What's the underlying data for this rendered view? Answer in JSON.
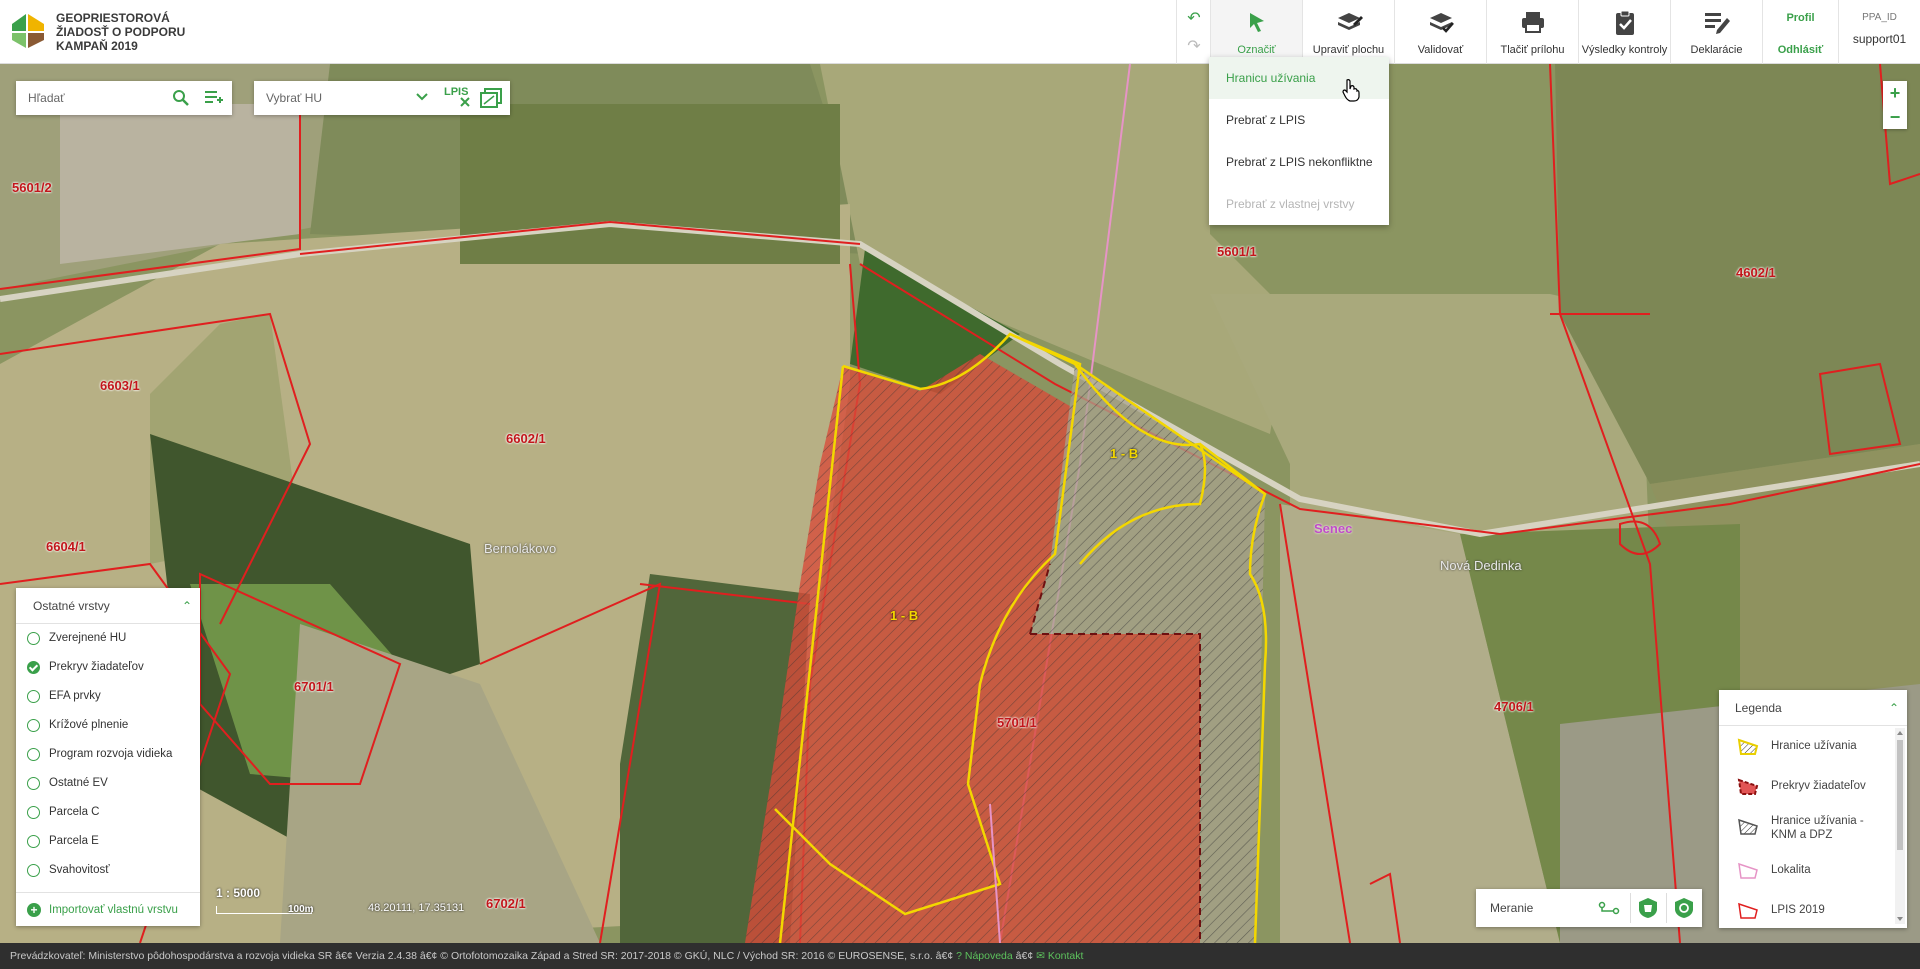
{
  "app": {
    "title_lines": [
      "GEOPRIESTOROVÁ",
      "ŽIADOSŤ O PODPORU",
      "KAMPAŇ 2019"
    ]
  },
  "toolbar": {
    "items": [
      {
        "label": "Označiť",
        "icon": "pointer-icon",
        "active": true
      },
      {
        "label": "Upraviť plochu",
        "icon": "edit-area-icon"
      },
      {
        "label": "Validovať",
        "icon": "validate-icon"
      },
      {
        "label": "Tlačiť prílohu",
        "icon": "print-icon"
      },
      {
        "label": "Výsledky kontroly",
        "icon": "clipboard-check-icon"
      },
      {
        "label": "Deklarácie",
        "icon": "declaration-icon"
      }
    ],
    "profile_label": "Profil",
    "logout_label": "Odhlásiť",
    "user_id_label": "PPA_ID",
    "user_name": "support01"
  },
  "dropdown": {
    "items": [
      {
        "label": "Hranicu užívania",
        "state": "active"
      },
      {
        "label": "Prebrať z LPIS",
        "state": "normal"
      },
      {
        "label": "Prebrať z LPIS nekonfliktne",
        "state": "normal"
      },
      {
        "label": "Prebrať z vlastnej vrstvy",
        "state": "disabled"
      }
    ]
  },
  "search": {
    "placeholder": "Hľadať",
    "hu_placeholder": "Vybrať HU",
    "lpis_label": "LPIS"
  },
  "layers": {
    "title": "Ostatné vrstvy",
    "items": [
      {
        "label": "Zverejnené HU",
        "checked": false
      },
      {
        "label": "Prekryv žiadateľov",
        "checked": true
      },
      {
        "label": "EFA prvky",
        "checked": false
      },
      {
        "label": "Krížové plnenie",
        "checked": false
      },
      {
        "label": "Program rozvoja vidieka",
        "checked": false
      },
      {
        "label": "Ostatné EV",
        "checked": false
      },
      {
        "label": "Parcela C",
        "checked": false
      },
      {
        "label": "Parcela E",
        "checked": false
      },
      {
        "label": "Svahovitosť",
        "checked": false
      }
    ],
    "import_label": "Importovať vlastnú vrstvu"
  },
  "legend": {
    "title": "Legenda",
    "items": [
      {
        "label": "Hranice užívania"
      },
      {
        "label": "Prekryv žiadateľov"
      },
      {
        "label": "Hranice užívania - KNM a DPZ"
      },
      {
        "label": "Lokalita"
      },
      {
        "label": "LPIS 2019"
      }
    ]
  },
  "measure": {
    "label": "Meranie"
  },
  "scale": {
    "ratio": "1 : 5000",
    "unit": "100m"
  },
  "coordinates": "48.20111, 17.35131",
  "map_labels": {
    "parcels": [
      "5601/2",
      "5601/1",
      "4602/1",
      "6603/1",
      "6602/1",
      "6604/1",
      "6701/1",
      "5701/1",
      "4706/1",
      "6702/1"
    ],
    "usage": [
      "1 - B",
      "1 - B"
    ],
    "towns": [
      "Bernolákovo",
      "Senec",
      "Nová Dedinka"
    ]
  },
  "footer": {
    "operator": "Prevádzkovateľ: Ministerstvo pôdohospodárstva a rozvoja vidieka SR â€¢ Verzia 2.4.38 â€¢ © Ortofotomozaika Západ a Stred SR: 2017-2018 © GKÚ, NLC / Východ SR: 2016 © EUROSENSE, s.r.o.  â€¢ ",
    "help": "Nápoveda",
    "sep": " â€¢ ",
    "contact": "Kontakt"
  },
  "colors": {
    "accent": "#3aa04a",
    "parcel_border": "#e01f1f",
    "usage_border": "#f3d700",
    "overlay_fill": "#d94a3a"
  }
}
